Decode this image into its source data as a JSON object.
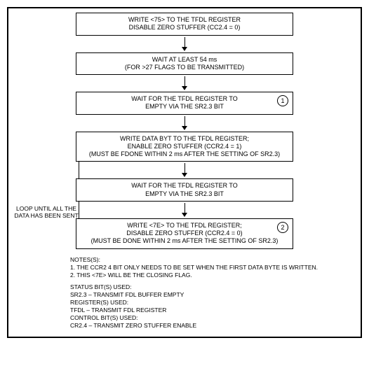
{
  "chart_data": {
    "type": "flowchart",
    "steps": [
      {
        "id": 1,
        "text": [
          "WRITE <75> TO THE TFDL REGISTER",
          "DISABLE ZERO STUFFER (CC2.4 = 0)"
        ]
      },
      {
        "id": 2,
        "text": [
          "WAIT AT LEAST 54 ms",
          "(FOR >27 FLAGS TO BE TRANSMITTED)"
        ]
      },
      {
        "id": 3,
        "badge": "1",
        "text": [
          "WAIT FOR THE TFDL REGISTER TO",
          "EMPTY VIA THE SR2.3 BIT"
        ]
      },
      {
        "id": 4,
        "text": [
          "WRITE DATA BYT TO THE TFDL REGISTER;",
          "ENABLE ZERO STUFFER (CCR2.4 = 1)",
          "(MUST BE FDONE WITHIN 2 ms AFTER THE SETTING OF SR2.3)"
        ]
      },
      {
        "id": 5,
        "text": [
          "WAIT FOR THE TFDL REGISTER TO",
          "EMPTY VIA THE SR2.3 BIT"
        ]
      },
      {
        "id": 6,
        "badge": "2",
        "text": [
          "WRITE <7E> TO THE TFDL REGISTER;",
          "DISABLE ZERO STUFFER (CCR2.4 = 0)",
          "(MUST BE DONE WITHIN 2 ms AFTER THE SETTING OF SR2.3)"
        ]
      }
    ],
    "loop": {
      "from_step": 5,
      "to_step": 4,
      "label": "LOOP UNTIL ALL THE DATA HAS BEEN SENT"
    }
  },
  "step1_l1": "WRITE <75> TO THE TFDL REGISTER",
  "step1_l2": "DISABLE ZERO STUFFER (CC2.4 = 0)",
  "step2_l1": "WAIT AT LEAST 54 ms",
  "step2_l2": "(FOR >27 FLAGS TO BE TRANSMITTED)",
  "step3_l1": "WAIT FOR THE TFDL REGISTER TO",
  "step3_l2": "EMPTY VIA THE SR2.3 BIT",
  "badge1": "1",
  "step4_l1": "WRITE DATA BYT TO THE TFDL REGISTER;",
  "step4_l2": "ENABLE ZERO STUFFER (CCR2.4 = 1)",
  "step4_l3": "(MUST BE FDONE WITHIN 2 ms AFTER THE SETTING OF SR2.3)",
  "step5_l1": "WAIT FOR THE TFDL REGISTER TO",
  "step5_l2": "EMPTY VIA THE SR2.3 BIT",
  "step6_l1": "WRITE <7E> TO THE TFDL REGISTER;",
  "step6_l2": "DISABLE ZERO STUFFER (CCR2.4 = 0)",
  "step6_l3": "(MUST BE DONE WITHIN 2 ms AFTER THE SETTING OF SR2.3)",
  "badge2": "2",
  "loop_l1": "LOOP UNTIL ALL THE",
  "loop_l2": "DATA HAS BEEN SENT",
  "notes_hdr": "NOTES(S):",
  "note1": "1.  THE CCR2 4 BIT ONLY NEEDS TO BE SET WHEN THE FIRST DATA BYTE IS WRITTEN.",
  "note2": "2.  THIS <7E> WILL BE THE CLOSING FLAG.",
  "status_hdr": "STATUS BIT(S) USED:",
  "status1": "SR2.3 – TRANSMIT FDL BUFFER EMPTY",
  "reg_hdr": "REGISTER(S) USED:",
  "reg1": "TFDL – TRANSMIT FDL REGISTER",
  "ctrl_hdr": "CONTROL BIT(S) USED:",
  "ctrl1": "CR2.4 – TRANSMIT ZERO STUFFER ENABLE"
}
